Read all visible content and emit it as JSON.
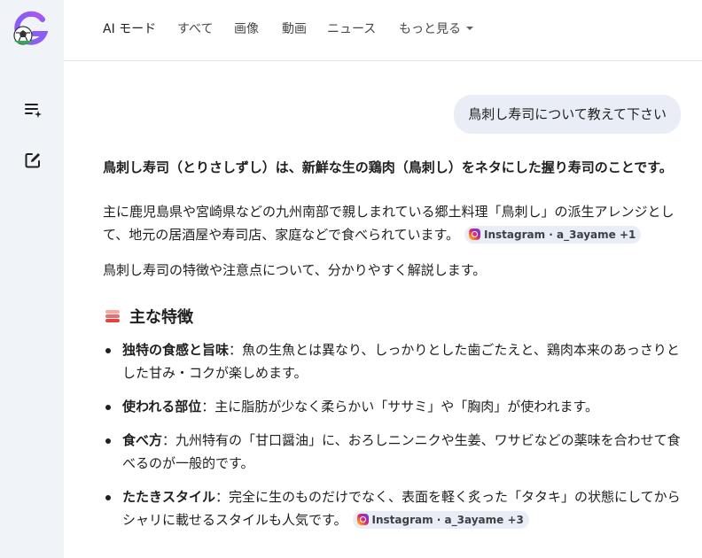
{
  "nav": {
    "tabs": [
      "AI モード",
      "すべて",
      "画像",
      "動画",
      "ニュース",
      "もっと見る"
    ]
  },
  "query": "鳥刺し寿司について教えて下さい",
  "answer": {
    "lead": "鳥刺し寿司（とりさしずし）は、新鮮な生の鶏肉（鳥刺し）をネタにした握り寿司のことです。",
    "intro": "主に鹿児島県や宮崎県などの九州南部で親しまれている郷土料理「鳥刺し」の派生アレンジとして、地元の居酒屋や寿司店、家庭などで食べられています。",
    "intro_source": "Instagram · a_3ayame +1",
    "summary": "鳥刺し寿司の特徴や注意点について、分かりやすく解説します。",
    "section_title": "主な特徴",
    "features": [
      {
        "term": "独特の食感と旨味",
        "text": "：魚の生魚とは異なり、しっかりとした歯ごたえと、鶏肉本来のあっさりとした甘み・コクが楽しめます。"
      },
      {
        "term": "使われる部位",
        "text": "：主に脂肪が少なく柔らかい「ササミ」や「胸肉」が使われます。"
      },
      {
        "term": "食べ方",
        "text": "：九州特有の「甘口醤油」に、おろしニンニクや生姜、ワサビなどの薬味を合わせて食べるのが一般的です。"
      },
      {
        "term": "たたきスタイル",
        "text": "：完全に生のものだけでなく、表面を軽く炙った「タタキ」の状態にしてからシャリに載せるスタイルも人気です。",
        "source": "Instagram · a_3ayame +3"
      }
    ]
  },
  "colors": {
    "rail": "#f0f4f9",
    "query_bubble": "#e9eef6",
    "text": "#1f1f1f"
  },
  "icons": {
    "logo": "google-g-soccer-logo",
    "rail_top": "new-list-sparkle-icon",
    "rail_bottom": "edit-icon",
    "section": "layered-stack-icon",
    "source": "instagram-icon"
  }
}
